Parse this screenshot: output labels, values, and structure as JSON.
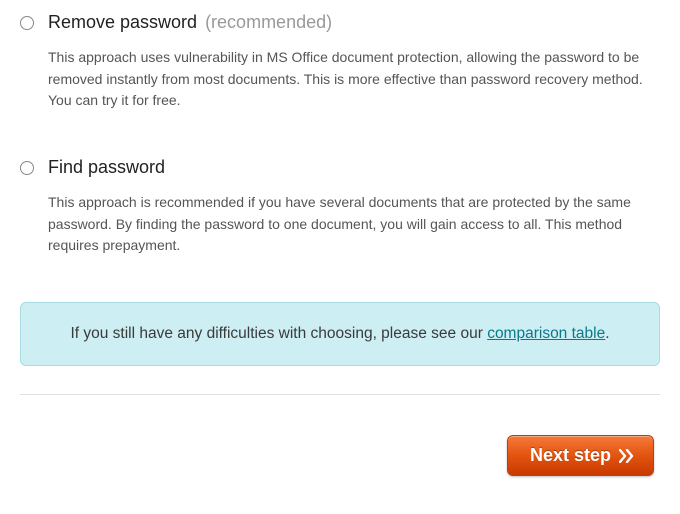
{
  "options": {
    "remove": {
      "title": "Remove password",
      "badge": "(recommended)",
      "desc": "This approach uses vulnerability in MS Office document protection, allowing the password to be removed instantly from most documents. This is more effective than password recovery method. You can try it for free."
    },
    "find": {
      "title": "Find password",
      "desc": "This approach is recommended if you have several documents that are protected by the same password. By finding the password to one document, you will gain access to all. This method requires prepayment."
    }
  },
  "info": {
    "prefix": "If you still have any difficulties with choosing, please see our ",
    "link": "comparison table",
    "suffix": "."
  },
  "buttons": {
    "next": "Next step"
  }
}
